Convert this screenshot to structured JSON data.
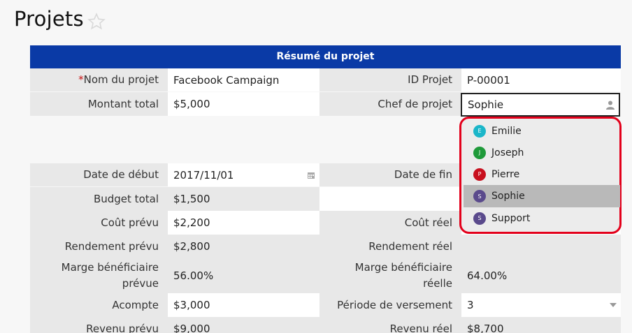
{
  "page": {
    "title": "Projets"
  },
  "section": {
    "title": "Résumé du projet"
  },
  "fields": {
    "project_name": {
      "required_mark": "*",
      "label": "Nom du projet",
      "value": "Facebook Campaign"
    },
    "project_id": {
      "label": "ID Projet",
      "value": "P-00001"
    },
    "total_amount": {
      "label": "Montant total",
      "value": "$5,000"
    },
    "project_manager": {
      "label": "Chef de projet",
      "value": "Sophie"
    },
    "start_date": {
      "label": "Date de début",
      "value": "2017/11/01"
    },
    "end_date": {
      "label": "Date de fin",
      "value": ""
    },
    "total_budget": {
      "label": "Budget total",
      "value": "$1,500"
    },
    "planned_cost": {
      "label": "Coût prévu",
      "value": "$2,200"
    },
    "actual_cost": {
      "label": "Coût réel",
      "value": ""
    },
    "planned_return": {
      "label": "Rendement prévu",
      "value": "$2,800"
    },
    "actual_return": {
      "label": "Rendement réel",
      "value": ""
    },
    "planned_margin": {
      "label_line1": "Marge bénéficiaire",
      "label_line2": "prévue",
      "value": "56.00%"
    },
    "actual_margin": {
      "label_line1": "Marge bénéficiaire",
      "label_line2": "réelle",
      "value": "64.00%"
    },
    "deposit": {
      "label": "Acompte",
      "value": "$3,000"
    },
    "payment_period": {
      "label": "Période de versement",
      "value": "3"
    },
    "planned_revenue": {
      "label": "Revenu prévu",
      "value": "$9,000"
    },
    "actual_revenue": {
      "label": "Revenu réel",
      "value": "$8,700"
    }
  },
  "manager_dropdown": {
    "options": [
      {
        "initial": "E",
        "name": "Emilie",
        "color": "#1bb6c9",
        "selected": false
      },
      {
        "initial": "J",
        "name": "Joseph",
        "color": "#1f9a3a",
        "selected": false
      },
      {
        "initial": "P",
        "name": "Pierre",
        "color": "#c8101e",
        "selected": false
      },
      {
        "initial": "S",
        "name": "Sophie",
        "color": "#5a4a8c",
        "selected": true
      },
      {
        "initial": "S",
        "name": "Support",
        "color": "#5a4a8c",
        "selected": false
      }
    ]
  },
  "colors": {
    "header": "#0a3aa6",
    "required": "#c81313",
    "highlight_border": "#e3001b"
  }
}
